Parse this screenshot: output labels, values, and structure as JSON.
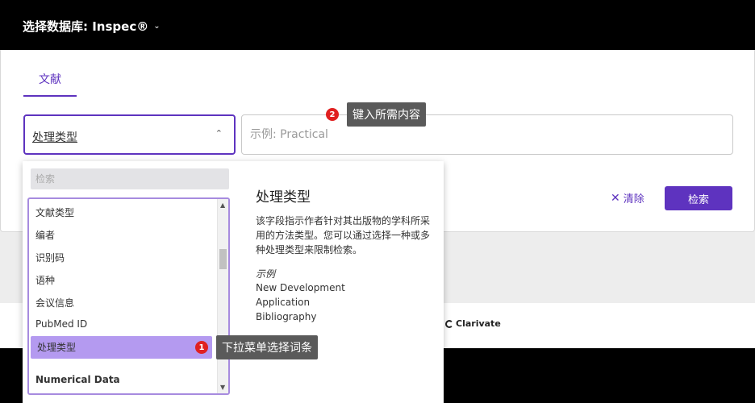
{
  "header": {
    "db_label": "选择数据库: Inspec®"
  },
  "tabs": [
    {
      "label": "文献"
    }
  ],
  "search_row": {
    "field_label": "处理类型",
    "query_placeholder": "示例: Practical"
  },
  "actions": {
    "clear_label": "清除",
    "search_label": "检索"
  },
  "dropdown": {
    "search_placeholder": "检索",
    "items": [
      "文献类型",
      "编者",
      "识别码",
      "语种",
      "会议信息",
      "PubMed ID",
      "处理类型"
    ],
    "selected_index": 6,
    "group_label": "Numerical Data"
  },
  "info_panel": {
    "title": "处理类型",
    "description": "该字段指示作者针对其出版物的学科所采用的方法类型。您可以通过选择一种或多种处理类型来限制检索。",
    "example_label": "示例",
    "examples": [
      "New Development",
      "Application",
      "Bibliography"
    ]
  },
  "footer": {
    "brand": "Clarivate"
  },
  "annotations": [
    {
      "number": "1",
      "text": "下拉菜单选择词条"
    },
    {
      "number": "2",
      "text": "键入所需内容"
    }
  ]
}
